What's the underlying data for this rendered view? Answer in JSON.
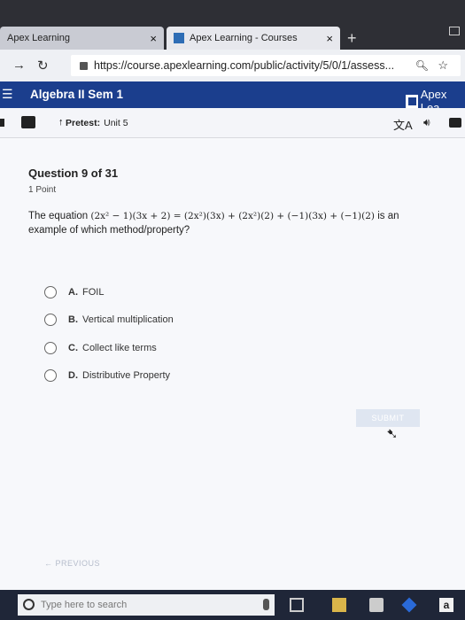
{
  "browser": {
    "tabs": [
      {
        "label": "Apex Learning",
        "icon": "apex-favicon"
      },
      {
        "label": "Apex Learning - Courses",
        "icon": "apex-favicon"
      }
    ],
    "tab_close_glyph": "×",
    "new_tab_glyph": "+",
    "url": "https://course.apexlearning.com/public/activity/5/0/1/assess..."
  },
  "course": {
    "title": "Algebra II Sem 1",
    "brand": "Apex Lea"
  },
  "toolbar": {
    "breadcrumb_bold": "Pretest:",
    "breadcrumb_unit": "Unit 5"
  },
  "question": {
    "header": "Question 9 of 31",
    "points": "1 Point",
    "text_prefix": "The equation",
    "equation": "(2x² − 1)(3x + 2) = (2x²)(3x) + (2x²)(2) + (−1)(3x) + (−1)(2)",
    "text_suffix": "is an example of which method/property?",
    "choices": [
      {
        "letter": "A.",
        "text": "FOIL"
      },
      {
        "letter": "B.",
        "text": "Vertical multiplication"
      },
      {
        "letter": "C.",
        "text": "Collect like terms"
      },
      {
        "letter": "D.",
        "text": "Distributive Property"
      }
    ]
  },
  "actions": {
    "submit": "SUBMIT",
    "previous": "← PREVIOUS"
  },
  "taskbar": {
    "search_placeholder": "Type here to search"
  },
  "colors": {
    "course_header": "#1b3e8d",
    "taskbar": "#1f2638"
  }
}
